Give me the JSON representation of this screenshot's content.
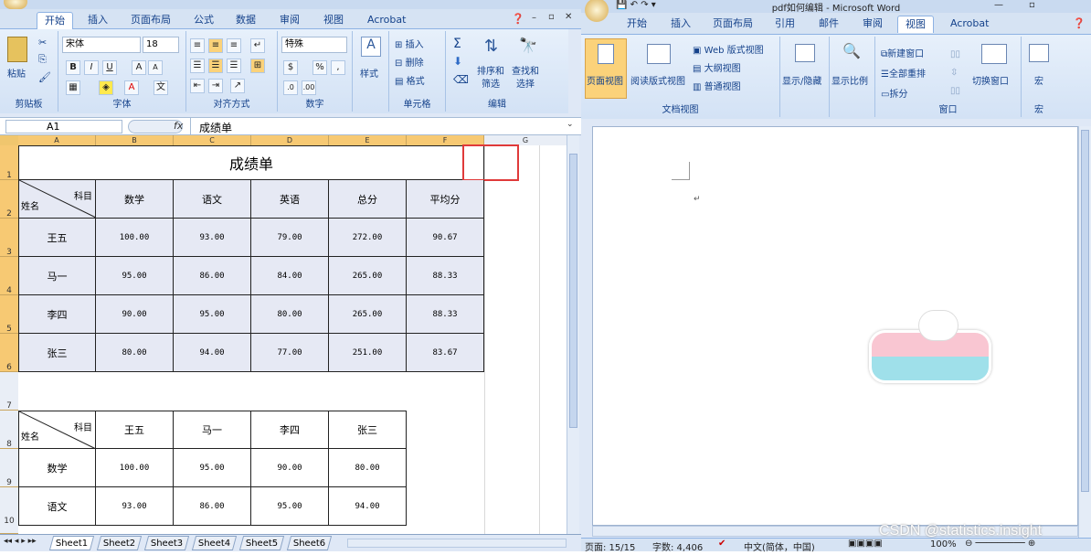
{
  "excel": {
    "tabs": [
      "开始",
      "插入",
      "页面布局",
      "公式",
      "数据",
      "审阅",
      "视图",
      "Acrobat"
    ],
    "groups": {
      "clipboard": "剪贴板",
      "font": "字体",
      "align": "对齐方式",
      "number": "数字",
      "cells": "单元格",
      "edit": "编辑"
    },
    "paste": "粘贴",
    "font_name": "宋体",
    "font_size": "18",
    "num_format": "特殊",
    "style": "样式",
    "insert": "插入",
    "delete": "删除",
    "format": "格式",
    "sort_filter": "排序和\n筛选",
    "find_select": "查找和\n选择",
    "pct": "%",
    "comma": ",",
    "cell_ref": "A1",
    "fx": "fx",
    "formula": "成绩单",
    "cols": [
      "A",
      "B",
      "C",
      "D",
      "E",
      "F",
      "G"
    ],
    "rows": [
      "1",
      "2",
      "3",
      "4",
      "5",
      "6",
      "7",
      "8",
      "9",
      "10"
    ],
    "title": "成绩单",
    "diag_top": "科目",
    "diag_bottom": "姓名",
    "headers": [
      "数学",
      "语文",
      "英语",
      "总分",
      "平均分"
    ],
    "table1": [
      {
        "name": "王五",
        "vals": [
          "100.00",
          "93.00",
          "79.00",
          "272.00",
          "90.67"
        ]
      },
      {
        "name": "马一",
        "vals": [
          "95.00",
          "86.00",
          "84.00",
          "265.00",
          "88.33"
        ]
      },
      {
        "name": "李四",
        "vals": [
          "90.00",
          "95.00",
          "80.00",
          "265.00",
          "88.33"
        ]
      },
      {
        "name": "张三",
        "vals": [
          "80.00",
          "94.00",
          "77.00",
          "251.00",
          "83.67"
        ]
      }
    ],
    "headers2": [
      "王五",
      "马一",
      "李四",
      "张三"
    ],
    "table2": [
      {
        "name": "数学",
        "vals": [
          "100.00",
          "95.00",
          "90.00",
          "80.00"
        ]
      },
      {
        "name": "语文",
        "vals": [
          "93.00",
          "86.00",
          "95.00",
          "94.00"
        ]
      }
    ],
    "sheets": [
      "Sheet1",
      "Sheet2",
      "Sheet3",
      "Sheet4",
      "Sheet5",
      "Sheet6"
    ]
  },
  "word": {
    "title": "pdf如何编辑 - Microsoft Word",
    "tabs": [
      "开始",
      "插入",
      "页面布局",
      "引用",
      "邮件",
      "审阅",
      "视图",
      "Acrobat"
    ],
    "page_view": "页面视图",
    "reading_view": "阅读版式视图",
    "web_view": "Web 版式视图",
    "outline": "大纲视图",
    "draft": "普通视图",
    "show_hide": "显示/隐藏",
    "zoom": "显示比例",
    "new_window": "新建窗口",
    "arrange_all": "全部重排",
    "split": "拆分",
    "switch_window": "切换窗口",
    "macro": "宏",
    "groups": {
      "views": "文档视图",
      "window": "窗口",
      "macros": "宏"
    },
    "status_page": "页面: 15/15",
    "status_words": "字数: 4,406",
    "status_lang": "中文(简体，中国)",
    "status_zoom": "100%"
  },
  "watermark": "CSDN @statistics.insight"
}
